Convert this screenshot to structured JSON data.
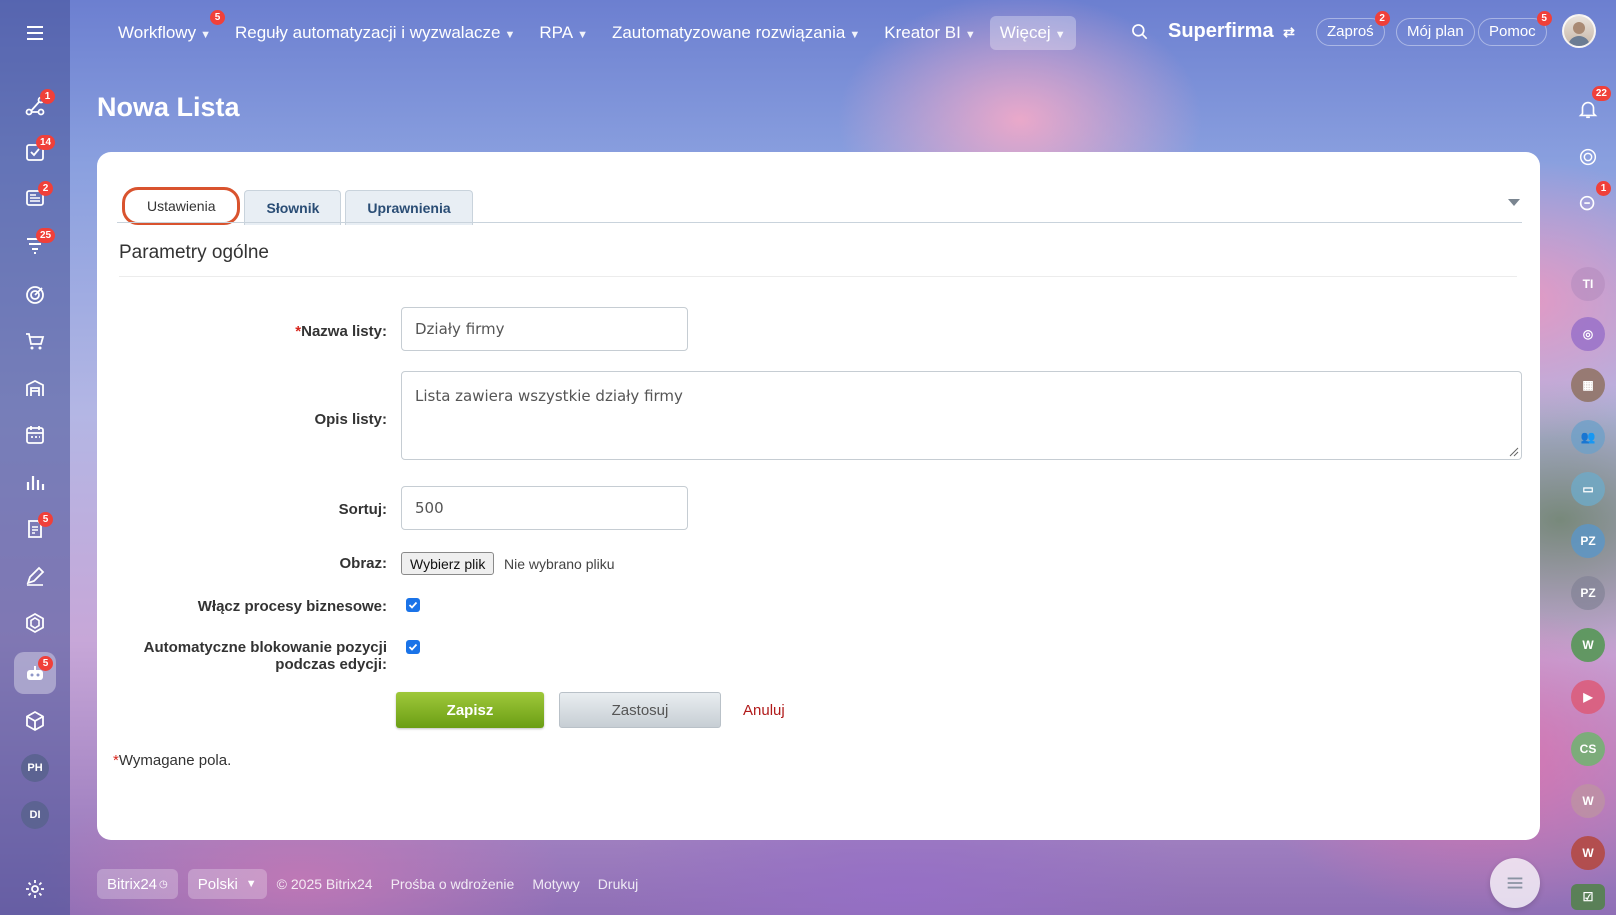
{
  "topnav": {
    "items": [
      {
        "label": "Workflowy",
        "badge": "5"
      },
      {
        "label": "Reguły automatyzacji i wyzwalacze"
      },
      {
        "label": "RPA"
      },
      {
        "label": "Zautomatyzowane rozwiązania"
      },
      {
        "label": "Kreator BI"
      },
      {
        "label": "Więcej"
      }
    ],
    "company": "Superfirma",
    "invite": {
      "label": "Zaproś",
      "badge": "2"
    },
    "plan": {
      "label": "Mój plan"
    },
    "help": {
      "label": "Pomoc",
      "badge": "5"
    }
  },
  "sidebar": {
    "badges": {
      "flows": "1",
      "tasks": "14",
      "feed": "2",
      "crm": "25",
      "docs": "5",
      "bots": "5"
    },
    "avatars": [
      "PH",
      "DI"
    ]
  },
  "rail": {
    "notifications_badge": "22",
    "chat_badge": "1",
    "avatars": [
      "TI",
      "PZ",
      "PZ",
      "W",
      "CS",
      "W",
      "W"
    ]
  },
  "page": {
    "title": "Nowa Lista"
  },
  "tabs": [
    "Ustawienia",
    "Słownik",
    "Uprawnienia"
  ],
  "form": {
    "section_title": "Parametry ogólne",
    "required_mark": "*",
    "name_label": "Nazwa listy:",
    "name_value": "Działy firmy",
    "desc_label": "Opis listy:",
    "desc_value": "Lista zawiera wszystkie działy firmy",
    "sort_label": "Sortuj:",
    "sort_value": "500",
    "image_label": "Obraz:",
    "file_button": "Wybierz plik",
    "file_none": "Nie wybrano pliku",
    "bp_label": "Włącz procesy biznesowe:",
    "bp_checked": true,
    "lock_label_1": "Automatyczne blokowanie pozycji",
    "lock_label_2": "podczas edycji:",
    "lock_checked": true,
    "save": "Zapisz",
    "apply": "Zastosuj",
    "cancel": "Anuluj",
    "required_note": "Wymagane pola."
  },
  "footer": {
    "brand": "Bitrix24",
    "language": "Polski",
    "copyright": "© 2025 Bitrix24",
    "links": [
      "Prośba o wdrożenie",
      "Motywy",
      "Drukuj"
    ]
  },
  "colors": {
    "accent_green": "#7bb31a",
    "badge_red": "#f0403a",
    "tab_highlight": "#d9532e"
  }
}
